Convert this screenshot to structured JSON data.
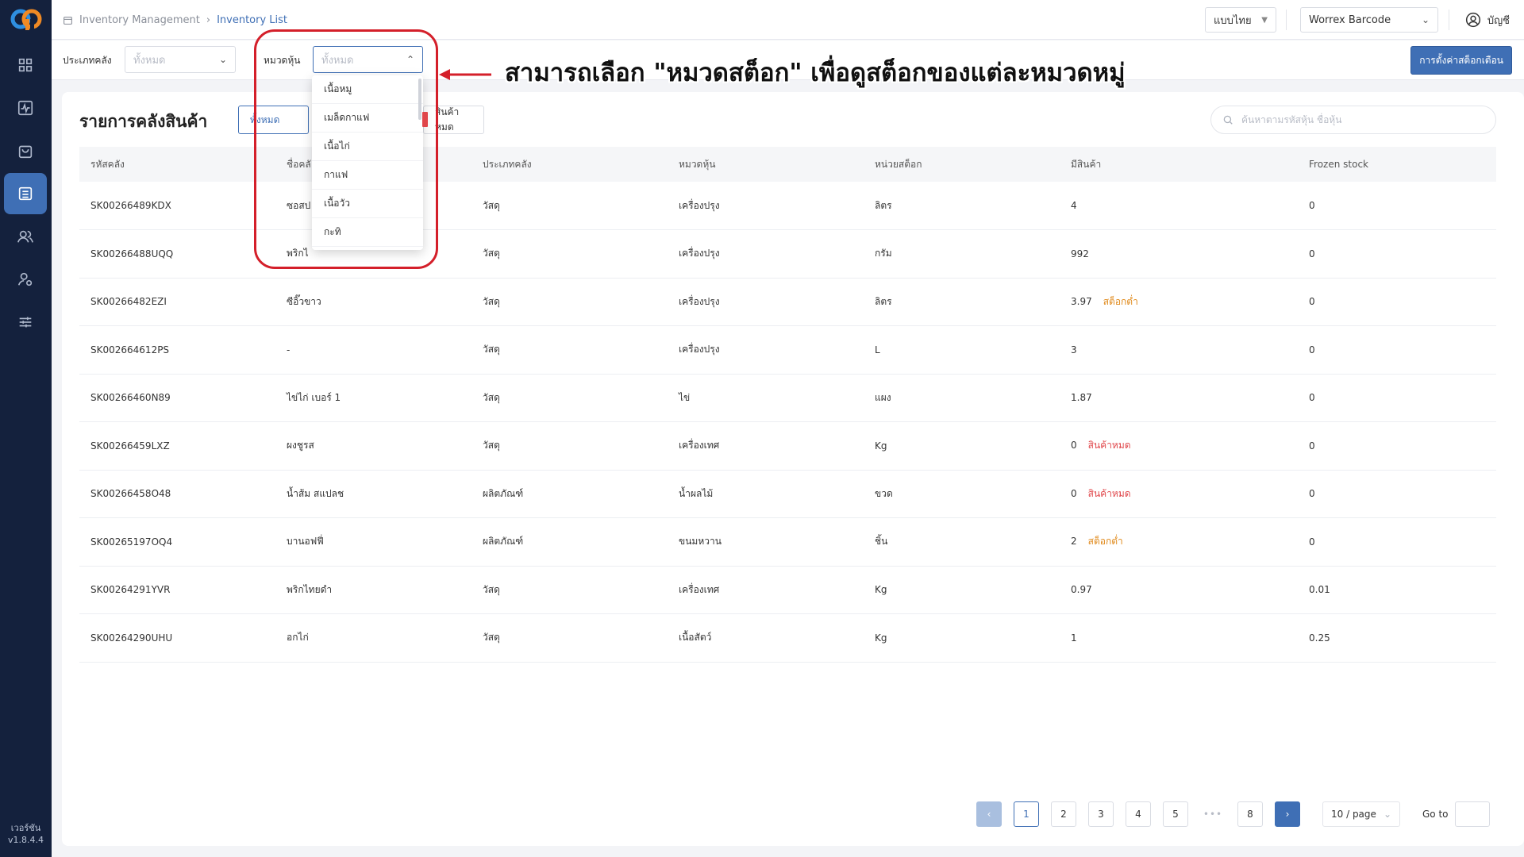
{
  "app": {
    "version_label": "เวอร์ชัน",
    "version": "v1.8.4.4"
  },
  "breadcrumb": {
    "parent": "Inventory Management",
    "current": "Inventory List"
  },
  "topbar": {
    "language": "แบบไทย",
    "store": "Worrex Barcode",
    "account_label": "บัญชี"
  },
  "filters": {
    "warehouse_type_label": "ประเภทคลัง",
    "warehouse_type_value": "ทั้งหมด",
    "category_label": "หมวดหุ้น",
    "category_value": "ทั้งหมด",
    "setting_button": "การตั้งค่าสต็อกเตือน",
    "category_options": [
      "เนื้อหมู",
      "เมล็ดกาแฟ",
      "เนื้อไก่",
      "กาแฟ",
      "เนื้อวัว",
      "กะทิ"
    ]
  },
  "list": {
    "title": "รายการคลังสินค้า",
    "tab_all": "ทั้งหมด",
    "tab_out": "สินค้าหมด",
    "search_placeholder": "ค้นหาตามรหัสหุ้น ชื่อหุ้น",
    "columns": [
      "รหัสคลัง",
      "ชื่อคลั",
      "ประเภทคลัง",
      "หมวดหุ้น",
      "หน่วยสต็อก",
      "มีสินค้า",
      "Frozen stock"
    ],
    "rows": [
      {
        "code": "SK00266489KDX",
        "name": "ซอสป",
        "type": "วัสดุ",
        "category": "เครื่องปรุง",
        "unit": "ลิตร",
        "qty": "4",
        "status": "",
        "frozen": "0"
      },
      {
        "code": "SK00266488UQQ",
        "name": "พริกไ",
        "type": "วัสดุ",
        "category": "เครื่องปรุง",
        "unit": "กรัม",
        "qty": "992",
        "status": "",
        "frozen": "0"
      },
      {
        "code": "SK00266482EZI",
        "name": "ซีอิ๊วขาว",
        "type": "วัสดุ",
        "category": "เครื่องปรุง",
        "unit": "ลิตร",
        "qty": "3.97",
        "status": "สต็อกต่ำ",
        "frozen": "0"
      },
      {
        "code": "SK002664612PS",
        "name": "-",
        "type": "วัสดุ",
        "category": "เครื่องปรุง",
        "unit": "L",
        "qty": "3",
        "status": "",
        "frozen": "0"
      },
      {
        "code": "SK00266460N89",
        "name": "ไข่ไก่ เบอร์ 1",
        "type": "วัสดุ",
        "category": "ไข่",
        "unit": "แผง",
        "qty": "1.87",
        "status": "",
        "frozen": "0"
      },
      {
        "code": "SK00266459LXZ",
        "name": "ผงชูรส",
        "type": "วัสดุ",
        "category": "เครื่องเทศ",
        "unit": "Kg",
        "qty": "0",
        "status": "สินค้าหมด",
        "frozen": "0"
      },
      {
        "code": "SK00266458O48",
        "name": "น้ำส้ม สแปลช",
        "type": "ผลิตภัณฑ์",
        "category": "น้ำผลไม้",
        "unit": "ขวด",
        "qty": "0",
        "status": "สินค้าหมด",
        "frozen": "0"
      },
      {
        "code": "SK00265197OQ4",
        "name": "บานอฟฟี่",
        "type": "ผลิตภัณฑ์",
        "category": "ขนมหวาน",
        "unit": "ชิ้น",
        "qty": "2",
        "status": "สต็อกต่ำ",
        "frozen": "0"
      },
      {
        "code": "SK00264291YVR",
        "name": "พริกไทยดำ",
        "type": "วัสดุ",
        "category": "เครื่องเทศ",
        "unit": "Kg",
        "qty": "0.97",
        "status": "",
        "frozen": "0.01"
      },
      {
        "code": "SK00264290UHU",
        "name": "อกไก่",
        "type": "วัสดุ",
        "category": "เนื้อสัตว์",
        "unit": "Kg",
        "qty": "1",
        "status": "",
        "frozen": "0.25"
      }
    ]
  },
  "pagination": {
    "pages": [
      "1",
      "2",
      "3",
      "4",
      "5"
    ],
    "last": "8",
    "dots": "•••",
    "page_size": "10 / page",
    "goto_label": "Go to"
  },
  "annotation": {
    "text": "สามารถเลือก \"หมวดสต็อก\" เพื่อดูสต็อกของแต่ละหมวดหมู่"
  },
  "colors": {
    "sidebar": "#14213d",
    "primary": "#3f6fb5",
    "warning": "#e08a1c",
    "danger": "#e0464a",
    "annotation": "#d41f2a"
  }
}
